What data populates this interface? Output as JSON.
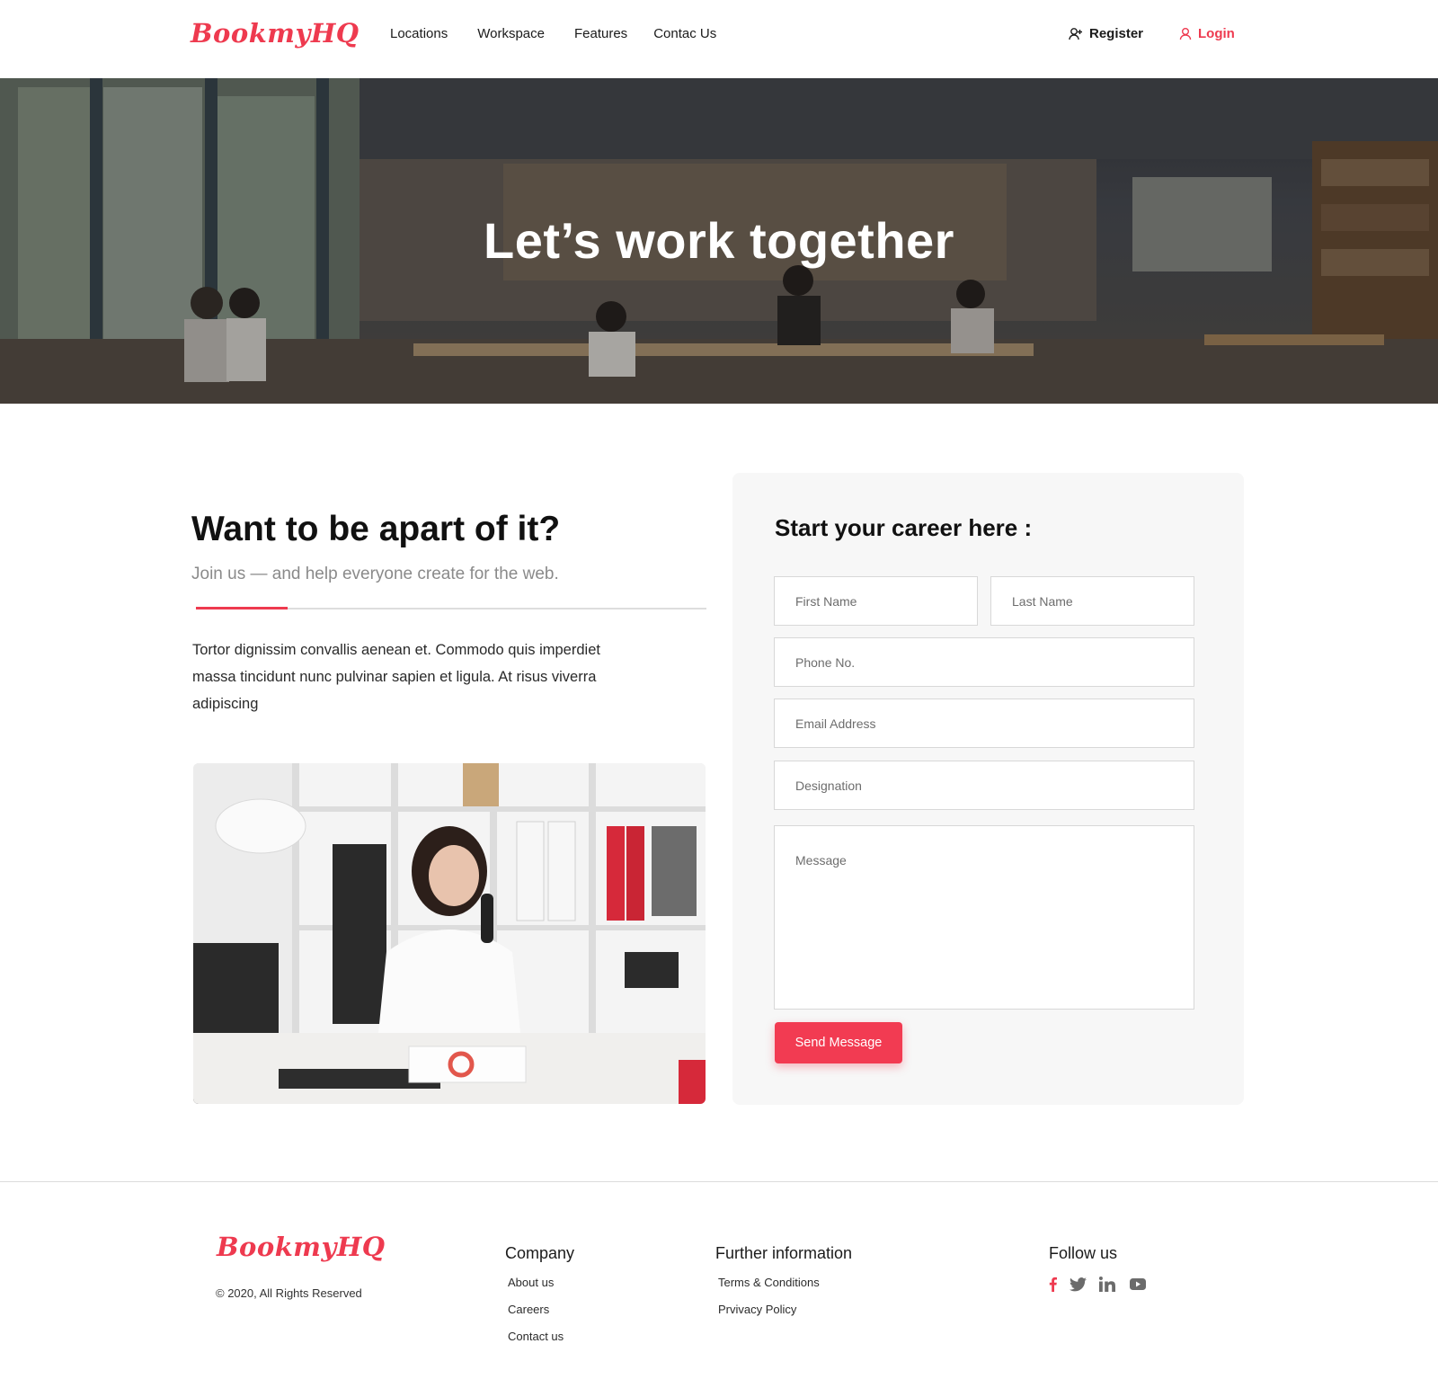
{
  "header": {
    "logo": "BookmyHQ",
    "nav": [
      "Locations",
      "Workspace",
      "Features",
      "Contac Us"
    ],
    "register": "Register",
    "login": "Login"
  },
  "hero": {
    "title": "Let’s work together"
  },
  "intro": {
    "title": "Want to be apart of it?",
    "subtitle": "Join us — and help everyone create for the web.",
    "body": "Tortor dignissim convallis aenean et. Commodo quis imperdiet massa tincidunt nunc pulvinar sapien et ligula. At risus viverra adipiscing"
  },
  "form": {
    "title": "Start your career here :",
    "first_name": "First Name",
    "last_name": "Last Name",
    "phone": "Phone No.",
    "email": "Email Address",
    "designation": "Designation",
    "message": "Message",
    "submit": "Send Message"
  },
  "footer": {
    "logo": "BookmyHQ",
    "copyright": "© 2020, All Rights Reserved",
    "company": {
      "heading": "Company",
      "links": [
        "About us",
        "Careers",
        "Contact us"
      ]
    },
    "further": {
      "heading": "Further information",
      "links": [
        "Terms & Conditions",
        "Prvivacy Policy"
      ]
    },
    "follow": {
      "heading": "Follow us",
      "icons": [
        "facebook-icon",
        "twitter-icon",
        "linkedin-icon",
        "youtube-icon"
      ]
    }
  },
  "colors": {
    "accent": "#ee3a4f",
    "button": "#f23b52",
    "card": "#f7f7f7",
    "muted": "#8a8a8a"
  }
}
